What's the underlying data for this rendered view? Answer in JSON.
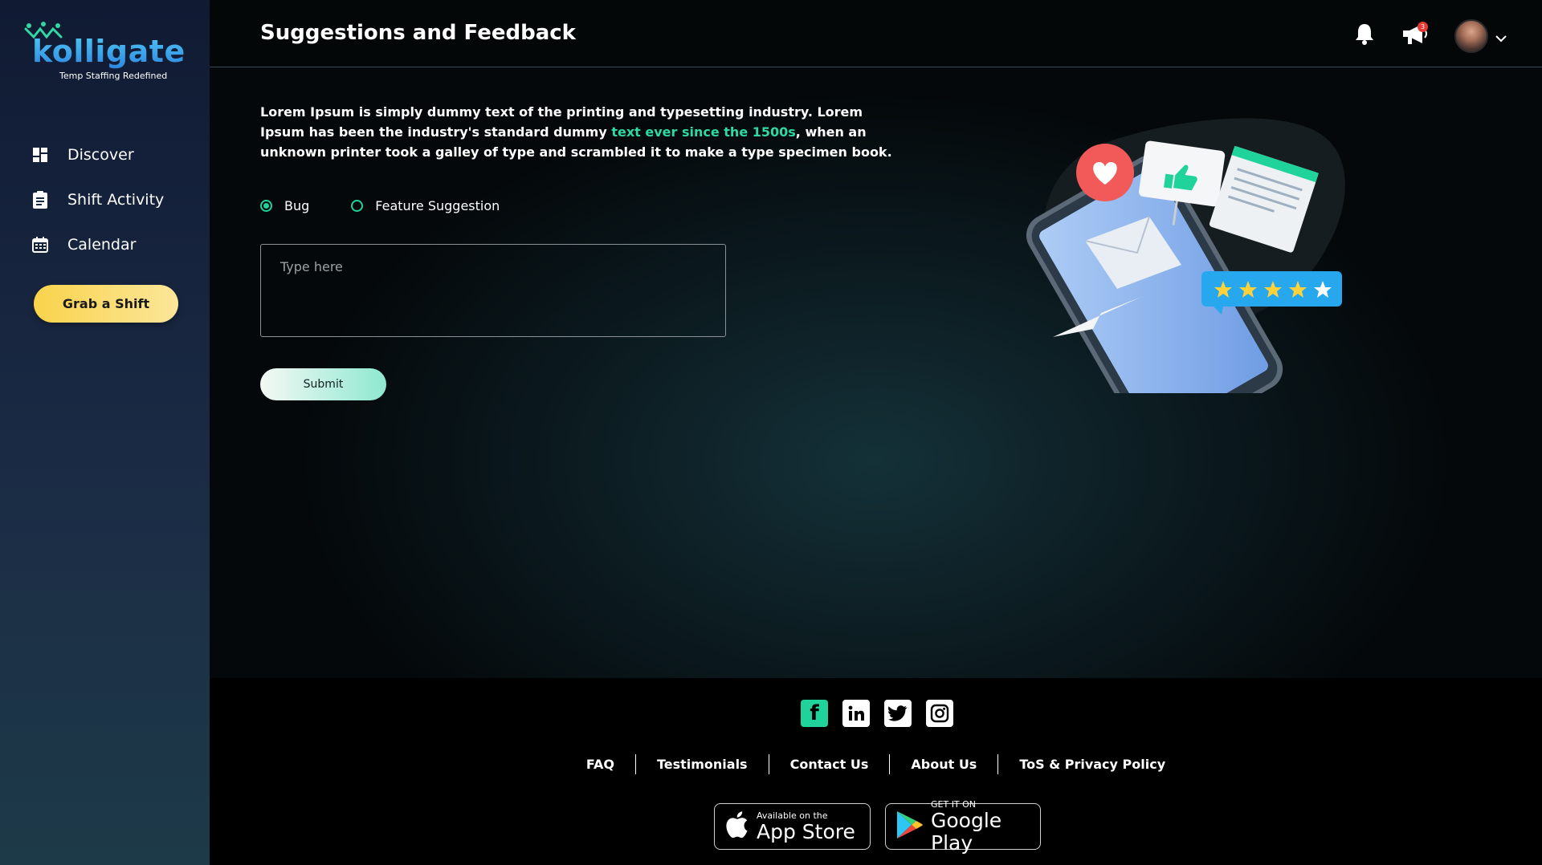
{
  "brand": {
    "name": "kolligate",
    "tagline": "Temp Staffing Redefined"
  },
  "sidebar": {
    "items": [
      {
        "label": "Discover",
        "icon": "grid-icon"
      },
      {
        "label": "Shift Activity",
        "icon": "clipboard-icon"
      },
      {
        "label": "Calendar",
        "icon": "calendar-icon"
      }
    ],
    "cta_label": "Grab a Shift"
  },
  "header": {
    "title": "Suggestions and Feedback",
    "announcement_count": "3"
  },
  "main": {
    "intro_part1": "Lorem Ipsum is simply dummy text of the printing and typesetting industry. Lorem Ipsum has been the industry's standard dummy ",
    "intro_highlight": "text ever since the 1500s",
    "intro_part2": ", when an unknown printer took a galley of type and scrambled it to make a type specimen book.",
    "options": [
      {
        "label": "Bug",
        "selected": true
      },
      {
        "label": "Feature Suggestion",
        "selected": false
      }
    ],
    "textarea": {
      "placeholder": "Type here",
      "value": ""
    },
    "submit_label": "Submit"
  },
  "footer": {
    "socials": [
      "facebook-icon",
      "linkedin-icon",
      "twitter-icon",
      "instagram-icon"
    ],
    "links": [
      "FAQ",
      "Testimonials",
      "Contact Us",
      "About Us",
      "ToS & Privacy Policy"
    ],
    "app_store": {
      "line1": "Available on the",
      "line2": "App Store"
    },
    "google_play": {
      "line1": "GET IT ON",
      "line2": "Google Play"
    }
  },
  "colors": {
    "accent": "#20d39a",
    "cta": "#f9d34b",
    "brand_blue": "#2e86e0"
  }
}
